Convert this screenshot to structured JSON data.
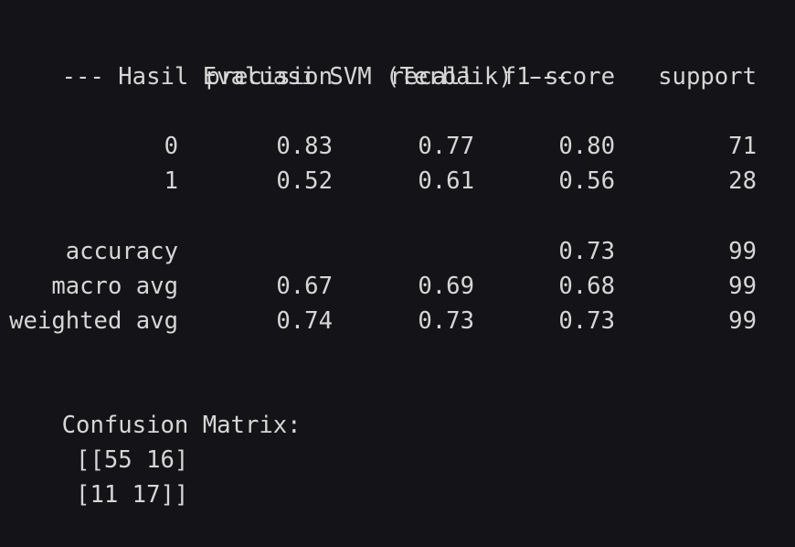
{
  "title_line": "--- Hasil Evaluasi SVM (Terbaik) ---",
  "headers": [
    "precision",
    "recall",
    "f1-score",
    "support"
  ],
  "rows": [
    {
      "label": "0",
      "precision": "0.83",
      "recall": "0.77",
      "f1": "0.80",
      "support": "71"
    },
    {
      "label": "1",
      "precision": "0.52",
      "recall": "0.61",
      "f1": "0.56",
      "support": "28"
    }
  ],
  "summary": [
    {
      "label": "accuracy",
      "precision": "",
      "recall": "",
      "f1": "0.73",
      "support": "99"
    },
    {
      "label": "macro avg",
      "precision": "0.67",
      "recall": "0.69",
      "f1": "0.68",
      "support": "99"
    },
    {
      "label": "weighted avg",
      "precision": "0.74",
      "recall": "0.73",
      "f1": "0.73",
      "support": "99"
    }
  ],
  "confusion_title": "Confusion Matrix:",
  "confusion_rows": [
    " [[55 16]",
    " [11 17]]"
  ]
}
